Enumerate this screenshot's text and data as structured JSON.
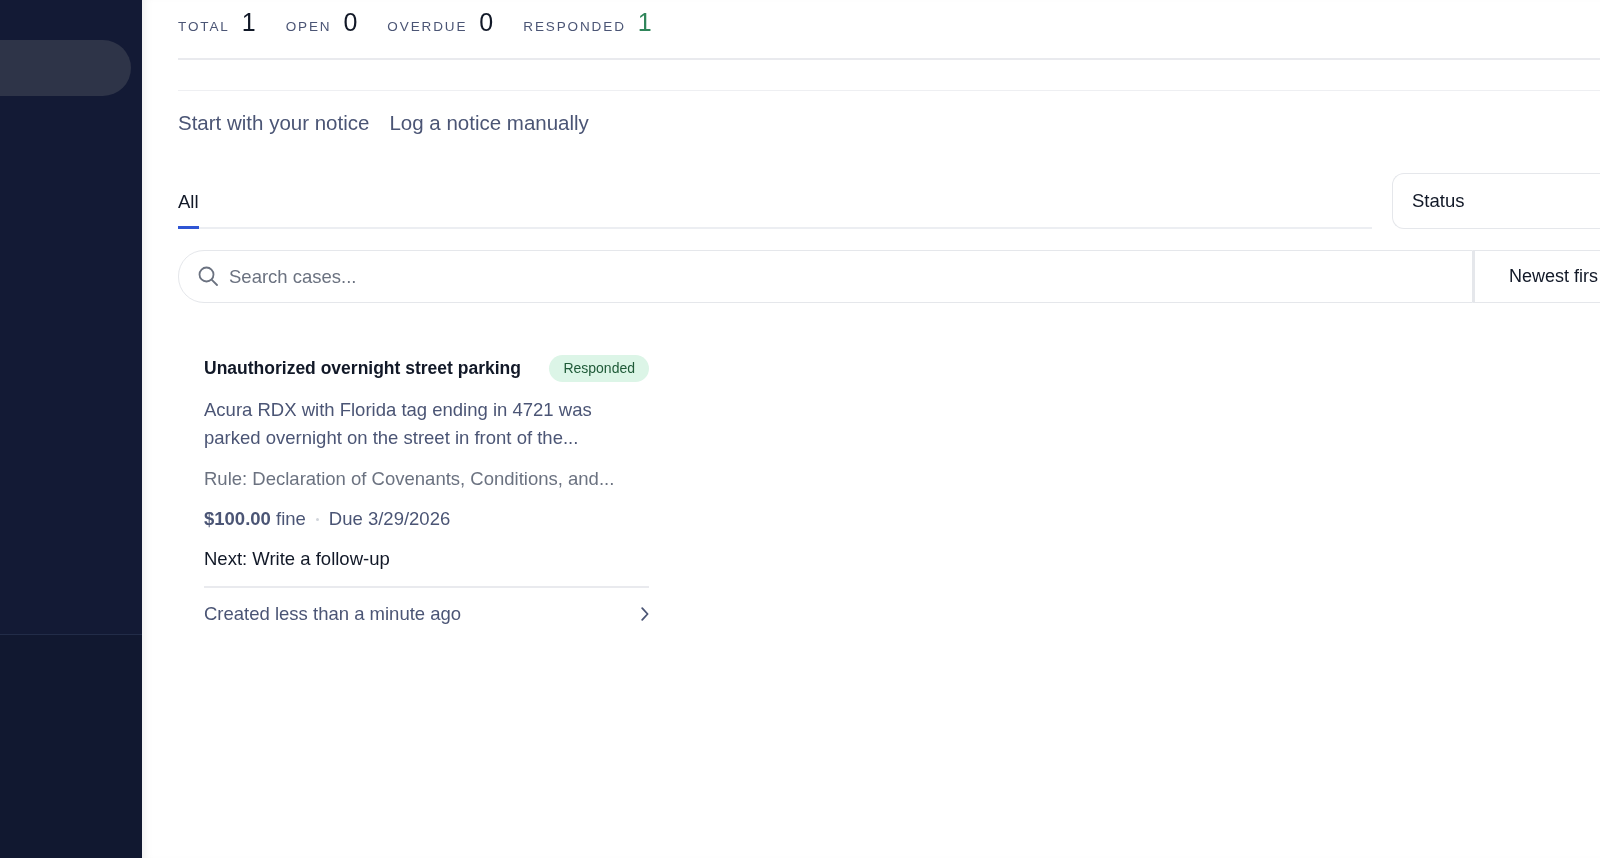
{
  "stats": [
    {
      "label": "TOTAL",
      "value": "1",
      "color": "#111827"
    },
    {
      "label": "OPEN",
      "value": "0",
      "color": "#111827"
    },
    {
      "label": "OVERDUE",
      "value": "0",
      "color": "#111827"
    },
    {
      "label": "RESPONDED",
      "value": "1",
      "color": "#2f855a"
    }
  ],
  "actions": [
    "Start with your notice",
    "Log a notice manually"
  ],
  "tabs": [
    {
      "label": "All",
      "selected": true
    }
  ],
  "status_filter": {
    "label": "Status"
  },
  "search": {
    "placeholder": "Search cases..."
  },
  "sort": {
    "value": "Newest firs"
  },
  "cases": [
    {
      "title": "Unauthorized overnight street parking",
      "status": {
        "label": "Responded",
        "kind": "responded"
      },
      "description": "Acura RDX with Florida tag ending in 4721 was parked overnight on the street in front of the...",
      "rule": "Rule: Declaration of Covenants, Conditions, and...",
      "fine": "**$100.00** fine",
      "due": "Due 3/29/2026",
      "next": "Next: Write a follow-up",
      "created": "Created less than a minute ago"
    }
  ]
}
